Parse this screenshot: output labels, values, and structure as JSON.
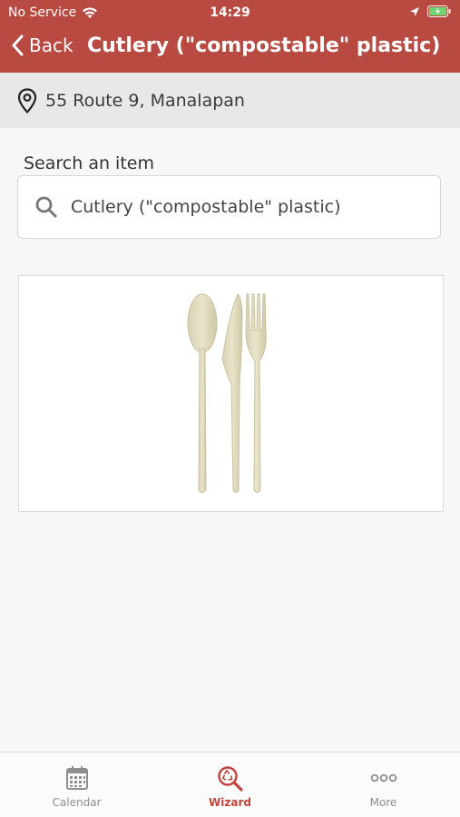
{
  "status_bar": {
    "carrier": "No Service",
    "time": "14:29"
  },
  "nav": {
    "back_label": "Back",
    "title": "Cutlery (\"compostable\" plastic)"
  },
  "location": {
    "address": "55 Route 9, Manalapan"
  },
  "search": {
    "label": "Search an item",
    "value": "Cutlery (\"compostable\" plastic)"
  },
  "tabs": [
    {
      "label": "Calendar",
      "icon": "calendar-icon",
      "active": false
    },
    {
      "label": "Wizard",
      "icon": "recycle-search-icon",
      "active": true
    },
    {
      "label": "More",
      "icon": "more-dots-icon",
      "active": false
    }
  ],
  "colors": {
    "brand": "#b94a42",
    "active_tab": "#c0443d",
    "inactive_tab": "#8e8e8e"
  }
}
